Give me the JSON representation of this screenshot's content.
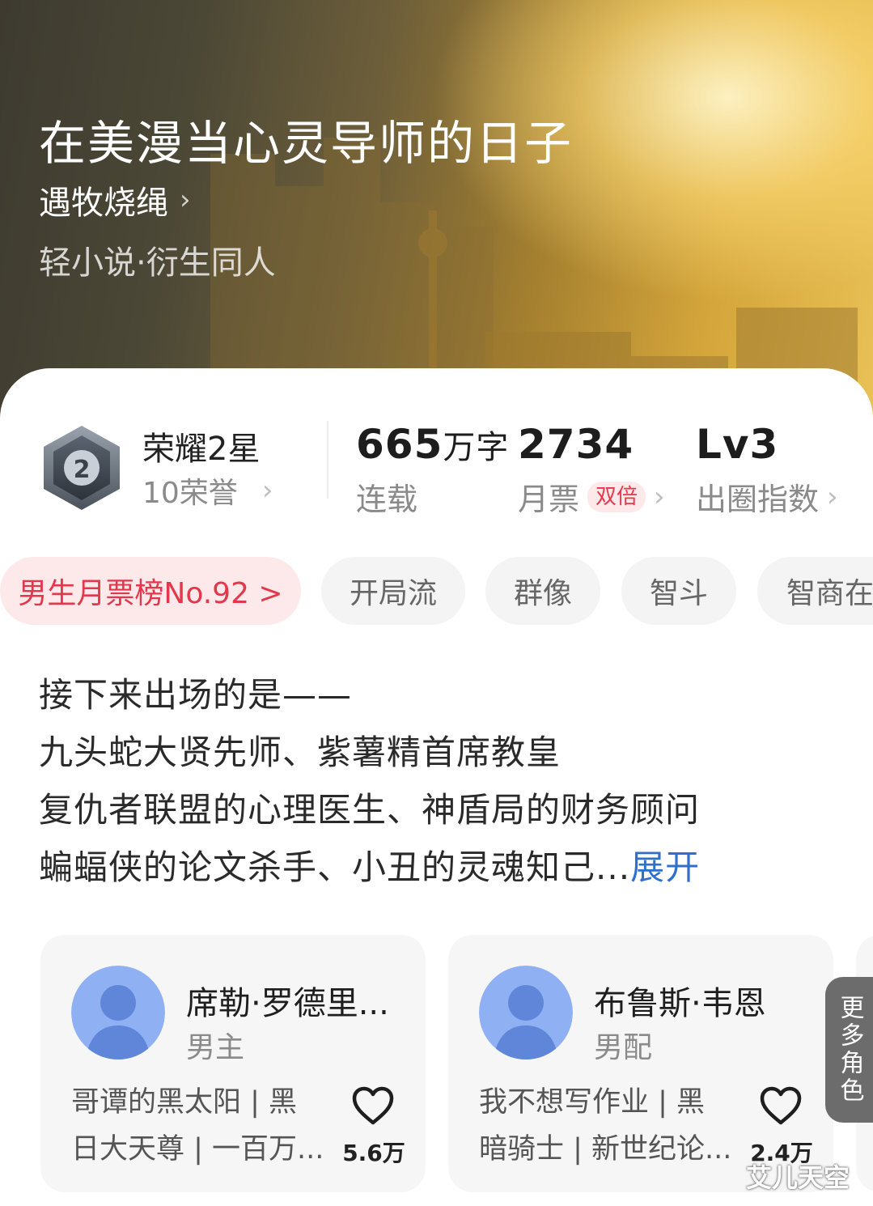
{
  "hero": {
    "title": "在美漫当心灵导师的日子",
    "author": "遇牧烧绳",
    "genre": "轻小说·衍生同人"
  },
  "honor": {
    "title": "荣耀2星",
    "subtitle": "10荣誉",
    "badge_icon": "medal-2-icon"
  },
  "stats": {
    "words_value": "665",
    "words_unit": "万字",
    "words_label": "连载",
    "tickets_value": "2734",
    "tickets_label": "月票",
    "tickets_chip": "双倍",
    "level_value": "Lv3",
    "level_label": "出圈指数"
  },
  "tags": [
    "男生月票榜No.92 >",
    "开局流",
    "群像",
    "智斗",
    "智商在"
  ],
  "synopsis": {
    "lines": [
      "接下来出场的是——",
      "九头蛇大贤先师、紫薯精首席教皇",
      "复仇者联盟的心理医生、神盾局的财务顾问",
      "蝙蝠侠的论文杀手、小丑的灵魂知己..."
    ],
    "expand": "展开"
  },
  "characters": [
    {
      "name": "席勒·罗德里...",
      "role": "男主",
      "desc1": "哥谭的黑太阳 | 黑",
      "desc2": "日大天尊 | 一百万...",
      "likes": "5.6万"
    },
    {
      "name": "布鲁斯·韦恩",
      "role": "男配",
      "desc1": "我不想写作业 | 黑",
      "desc2": "暗骑士 | 新世纪论...",
      "likes": "2.4万"
    }
  ],
  "more_roles": "更多角色",
  "watermark": "艾儿天空",
  "colors": {
    "accent_red": "#e3374b",
    "link_blue": "#2f6fce",
    "avatar_blue": "#7fa6f0"
  }
}
